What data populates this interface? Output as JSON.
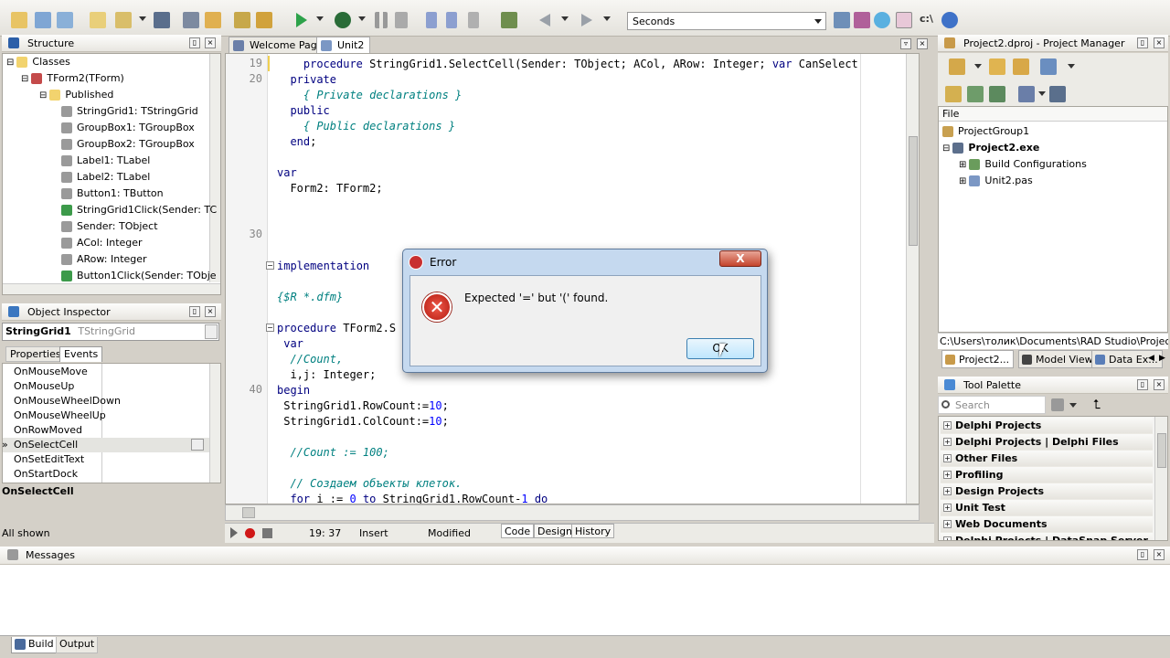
{
  "toolbar": {
    "seconds_select": "Seconds"
  },
  "structure": {
    "title": "Structure",
    "items": [
      {
        "label": "Classes"
      },
      {
        "label": "TForm2(TForm)"
      },
      {
        "label": "Published"
      },
      {
        "label": "StringGrid1: TStringGrid"
      },
      {
        "label": "GroupBox1: TGroupBox"
      },
      {
        "label": "GroupBox2: TGroupBox"
      },
      {
        "label": "Label1: TLabel"
      },
      {
        "label": "Label2: TLabel"
      },
      {
        "label": "Button1: TButton"
      },
      {
        "label": "StringGrid1Click(Sender: TC"
      },
      {
        "label": "Sender: TObject"
      },
      {
        "label": "ACol: Integer"
      },
      {
        "label": "ARow: Integer"
      },
      {
        "label": "Button1Click(Sender: TObje"
      }
    ]
  },
  "object_inspector": {
    "title": "Object Inspector",
    "component": "StringGrid1",
    "component_type": "TStringGrid",
    "tabs": [
      "Properties",
      "Events"
    ],
    "events": [
      "OnMouseMove",
      "OnMouseUp",
      "OnMouseWheelDown",
      "OnMouseWheelUp",
      "OnRowMoved",
      "OnSelectCell",
      "OnSetEditText",
      "OnStartDock"
    ],
    "selected_event": "OnSelectCell",
    "status": "All shown"
  },
  "editor": {
    "tabs": [
      "Welcome Page",
      "Unit2"
    ],
    "line_numbers": [
      {
        "n": "19",
        "row": 0
      },
      {
        "n": "20",
        "row": 1
      },
      {
        "n": "30",
        "row": 11
      },
      {
        "n": "40",
        "row": 21
      }
    ],
    "lines": [
      {
        "row": 0,
        "indent": 4,
        "parts": [
          {
            "t": "procedure ",
            "c": "kw"
          },
          {
            "t": "StringGrid1.SelectCell(Sender: TObject; ACol, ARow: Integer; ",
            "c": ""
          },
          {
            "t": "var",
            "c": "kw"
          },
          {
            "t": " CanSelect",
            "c": ""
          }
        ]
      },
      {
        "row": 1,
        "indent": 2,
        "parts": [
          {
            "t": "private",
            "c": "kw"
          }
        ]
      },
      {
        "row": 2,
        "indent": 4,
        "parts": [
          {
            "t": "{ Private declarations }",
            "c": "cm"
          }
        ]
      },
      {
        "row": 3,
        "indent": 2,
        "parts": [
          {
            "t": "public",
            "c": "kw"
          }
        ]
      },
      {
        "row": 4,
        "indent": 4,
        "parts": [
          {
            "t": "{ Public declarations }",
            "c": "cm"
          }
        ]
      },
      {
        "row": 5,
        "indent": 2,
        "parts": [
          {
            "t": "end",
            "c": "kw"
          },
          {
            "t": ";",
            "c": ""
          }
        ]
      },
      {
        "row": 7,
        "indent": 0,
        "parts": [
          {
            "t": "var",
            "c": "kw"
          }
        ]
      },
      {
        "row": 8,
        "indent": 2,
        "parts": [
          {
            "t": "Form2: TForm2;",
            "c": ""
          }
        ]
      },
      {
        "row": 13,
        "indent": 0,
        "parts": [
          {
            "t": "implementation",
            "c": "kw"
          }
        ]
      },
      {
        "row": 15,
        "indent": 0,
        "parts": [
          {
            "t": "{$R *.dfm}",
            "c": "cm"
          }
        ]
      },
      {
        "row": 17,
        "indent": 0,
        "parts": [
          {
            "t": "procedure ",
            "c": "kw"
          },
          {
            "t": "TForm2.S",
            "c": ""
          }
        ]
      },
      {
        "row": 18,
        "indent": 1,
        "parts": [
          {
            "t": "var",
            "c": "kw"
          }
        ]
      },
      {
        "row": 19,
        "indent": 2,
        "parts": [
          {
            "t": "//Count,",
            "c": "cm"
          }
        ]
      },
      {
        "row": 20,
        "indent": 2,
        "parts": [
          {
            "t": "i,j: Integer;",
            "c": ""
          }
        ]
      },
      {
        "row": 21,
        "indent": 0,
        "parts": [
          {
            "t": "begin",
            "c": "kw"
          }
        ]
      },
      {
        "row": 22,
        "indent": 1,
        "parts": [
          {
            "t": "StringGrid1.RowCount:=",
            "c": ""
          },
          {
            "t": "10",
            "c": "nm"
          },
          {
            "t": ";",
            "c": ""
          }
        ]
      },
      {
        "row": 23,
        "indent": 1,
        "parts": [
          {
            "t": "StringGrid1.ColCount:=",
            "c": ""
          },
          {
            "t": "10",
            "c": "nm"
          },
          {
            "t": ";",
            "c": ""
          }
        ]
      },
      {
        "row": 25,
        "indent": 2,
        "parts": [
          {
            "t": "//Count := 100;",
            "c": "cm"
          }
        ]
      },
      {
        "row": 27,
        "indent": 2,
        "parts": [
          {
            "t": "// Создаем объекты клеток.",
            "c": "cm"
          }
        ]
      },
      {
        "row": 28,
        "indent": 2,
        "parts": [
          {
            "t": "for",
            "c": "kw"
          },
          {
            "t": " i := ",
            "c": ""
          },
          {
            "t": "0",
            "c": "nm"
          },
          {
            "t": " ",
            "c": ""
          },
          {
            "t": "to",
            "c": "kw"
          },
          {
            "t": " StringGrid1.RowCount-",
            "c": ""
          },
          {
            "t": "1",
            "c": "nm"
          },
          {
            "t": " ",
            "c": ""
          },
          {
            "t": "do",
            "c": "kw"
          }
        ]
      }
    ]
  },
  "status_bar": {
    "position": "19: 37",
    "mode": "Insert",
    "state": "Modified",
    "view_tabs": [
      "Code",
      "Design",
      "History"
    ]
  },
  "error_dialog": {
    "title": "Error",
    "message": "Expected '=' but '(' found.",
    "ok_label": "OK",
    "close_label": "X"
  },
  "project_manager": {
    "title": "Project2.dproj - Project Manager",
    "file_header": "File",
    "items": [
      {
        "label": "ProjectGroup1"
      },
      {
        "label": "Project2.exe"
      },
      {
        "label": "Build Configurations"
      },
      {
        "label": "Unit2.pas"
      }
    ],
    "path": "C:\\Users\\толик\\Documents\\RAD Studio\\Projects\\New",
    "bottom_tabs": [
      "Project2...",
      "Model View",
      "Data Ex..."
    ]
  },
  "tool_palette": {
    "title": "Tool Palette",
    "search_placeholder": "Search",
    "categories": [
      "Delphi Projects",
      "Delphi Projects | Delphi Files",
      "Other Files",
      "Profiling",
      "Design Projects",
      "Unit Test",
      "Web Documents",
      "Delphi Projects | DataSnap Server"
    ]
  },
  "messages": {
    "title": "Messages",
    "tabs": [
      "Build",
      "Output"
    ]
  }
}
